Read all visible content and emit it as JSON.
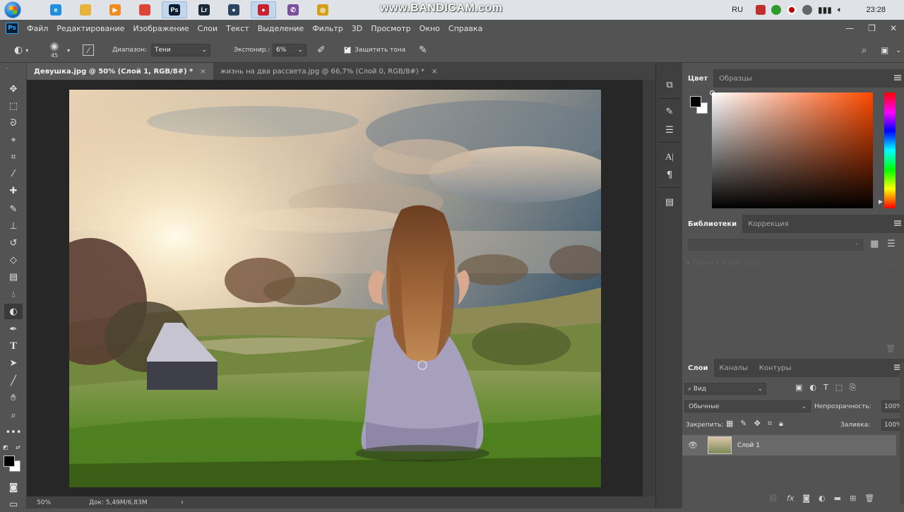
{
  "taskbar": {
    "watermark": "www.BANDICAM.com",
    "language": "RU",
    "clock": "23:28",
    "apps": [
      {
        "name": "ie",
        "color": "#1e8fe1",
        "glyph": "e",
        "active": false
      },
      {
        "name": "explorer",
        "color": "#e8b33a",
        "glyph": "",
        "active": false
      },
      {
        "name": "media",
        "color": "#f28b1c",
        "glyph": "▶",
        "active": false
      },
      {
        "name": "chrome",
        "color": "#db4437",
        "glyph": "",
        "active": false
      },
      {
        "name": "photoshop",
        "color": "#0a1e33",
        "glyph": "Ps",
        "active": true
      },
      {
        "name": "lightroom",
        "color": "#1c2a38",
        "glyph": "Lr",
        "active": false
      },
      {
        "name": "camera",
        "color": "#2b4560",
        "glyph": "●",
        "active": false
      },
      {
        "name": "bandicam",
        "color": "#c9222d",
        "glyph": "●",
        "active": true
      },
      {
        "name": "viber",
        "color": "#7b519d",
        "glyph": "✆",
        "active": false
      },
      {
        "name": "coins",
        "color": "#d4a017",
        "glyph": "◎",
        "active": false
      }
    ]
  },
  "menubar": {
    "logo": "Ps",
    "items": [
      "Файл",
      "Редактирование",
      "Изображение",
      "Слои",
      "Текст",
      "Выделение",
      "Фильтр",
      "3D",
      "Просмотр",
      "Окно",
      "Справка"
    ]
  },
  "options": {
    "brush_size": "45",
    "range_label": "Диапазон:",
    "range_value": "Тени",
    "exposure_label": "Экспонир.:",
    "exposure_value": "6%",
    "protect_tones_label": "Защитить тона",
    "protect_tones_checked": true
  },
  "tabs": [
    {
      "label": "Девушка.jpg @ 50% (Слой 1, RGB/8#) *",
      "active": true
    },
    {
      "label": "жизнь на два рассвета.jpg @ 66,7% (Слой 0, RGB/8#) *",
      "active": false
    }
  ],
  "status": {
    "zoom": "50%",
    "doc": "Док: 5,49M/6,83M"
  },
  "color_panel": {
    "tabs": [
      "Цвет",
      "Образцы"
    ],
    "foreground": "#000000",
    "background": "#ffffff"
  },
  "libraries_panel": {
    "tabs": [
      "Библиотеки",
      "Коррекция"
    ],
    "search_placeholder": "Поиск в Adobe Stock"
  },
  "layers_panel": {
    "tabs": [
      "Слои",
      "Каналы",
      "Контуры"
    ],
    "filter_label": "Вид",
    "blend_mode": "Обычные",
    "opacity_label": "Непрозрачность:",
    "opacity_value": "100%",
    "lock_label": "Закрепить:",
    "fill_label": "Заливка:",
    "fill_value": "100%",
    "layers": [
      {
        "name": "Слой 1",
        "visible": true,
        "selected": true
      }
    ]
  }
}
